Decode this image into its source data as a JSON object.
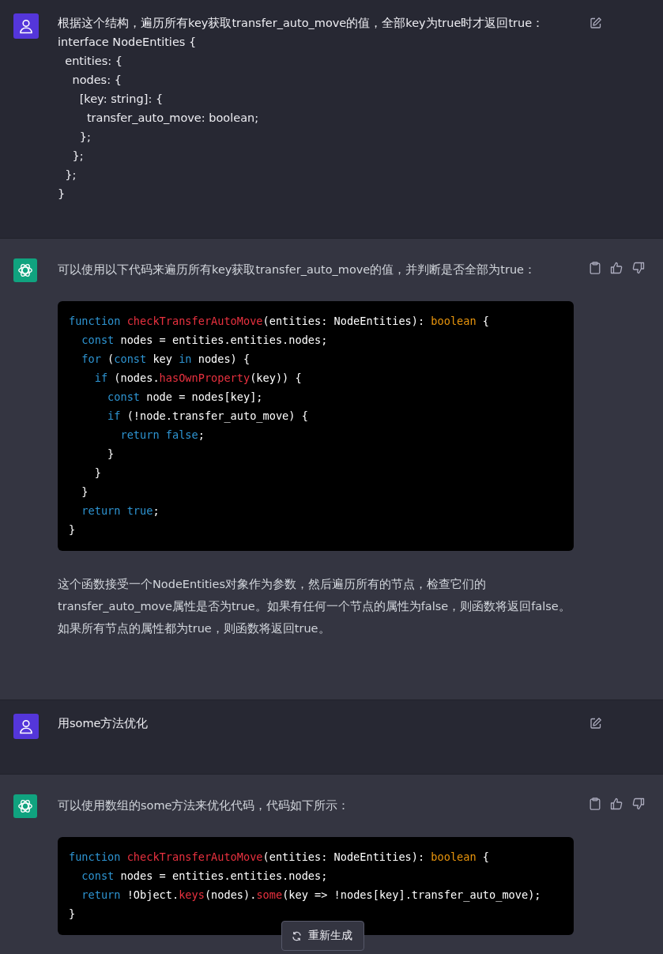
{
  "messages": [
    {
      "kind": "user",
      "blocks": [
        {
          "kind": "text",
          "text": "根据这个结构，遍历所有key获取transfer_auto_move的值，全部key为true时才返回true：\ninterface NodeEntities {\n  entities: {\n    nodes: {\n      [key: string]: {\n        transfer_auto_move: boolean;\n      };\n    };\n  };\n}"
        }
      ]
    },
    {
      "kind": "assistant",
      "blocks": [
        {
          "kind": "text",
          "text": "可以使用以下代码来遍历所有key获取transfer_auto_move的值，并判断是否全部为true："
        },
        {
          "kind": "code",
          "lines": [
            [
              {
                "kind": "keyword",
                "text": "function "
              },
              {
                "kind": "function",
                "text": "checkTransferAutoMove"
              },
              {
                "kind": "plain",
                "text": "(entities: NodeEntities): "
              },
              {
                "kind": "type",
                "text": "boolean"
              },
              {
                "kind": "plain",
                "text": " {"
              }
            ],
            [
              {
                "kind": "keyword",
                "text": "  const"
              },
              {
                "kind": "plain",
                "text": " nodes = entities.entities.nodes;"
              }
            ],
            [
              {
                "kind": "keyword",
                "text": "  for"
              },
              {
                "kind": "plain",
                "text": " ("
              },
              {
                "kind": "keyword",
                "text": "const"
              },
              {
                "kind": "plain",
                "text": " key "
              },
              {
                "kind": "keyword",
                "text": "in"
              },
              {
                "kind": "plain",
                "text": " nodes) {"
              }
            ],
            [
              {
                "kind": "keyword",
                "text": "    if"
              },
              {
                "kind": "plain",
                "text": " (nodes."
              },
              {
                "kind": "function",
                "text": "hasOwnProperty"
              },
              {
                "kind": "plain",
                "text": "(key)) {"
              }
            ],
            [
              {
                "kind": "keyword",
                "text": "      const"
              },
              {
                "kind": "plain",
                "text": " node = nodes[key];"
              }
            ],
            [
              {
                "kind": "keyword",
                "text": "      if"
              },
              {
                "kind": "plain",
                "text": " (!node.transfer_auto_move) {"
              }
            ],
            [
              {
                "kind": "keyword",
                "text": "        return false"
              },
              {
                "kind": "plain",
                "text": ";"
              }
            ],
            [
              {
                "kind": "plain",
                "text": "      }"
              }
            ],
            [
              {
                "kind": "plain",
                "text": "    }"
              }
            ],
            [
              {
                "kind": "plain",
                "text": "  }"
              }
            ],
            [
              {
                "kind": "keyword",
                "text": "  return true"
              },
              {
                "kind": "plain",
                "text": ";"
              }
            ],
            [
              {
                "kind": "plain",
                "text": "}"
              }
            ]
          ]
        },
        {
          "kind": "text",
          "text": "这个函数接受一个NodeEntities对象作为参数，然后遍历所有的节点，检查它们的transfer_auto_move属性是否为true。如果有任何一个节点的属性为false，则函数将返回false。如果所有节点的属性都为true，则函数将返回true。"
        }
      ]
    },
    {
      "kind": "user",
      "blocks": [
        {
          "kind": "text",
          "text": "用some方法优化"
        }
      ]
    },
    {
      "kind": "assistant",
      "blocks": [
        {
          "kind": "text",
          "text": "可以使用数组的some方法来优化代码，代码如下所示："
        },
        {
          "kind": "code",
          "lines": [
            [
              {
                "kind": "keyword",
                "text": "function "
              },
              {
                "kind": "function",
                "text": "checkTransferAutoMove"
              },
              {
                "kind": "plain",
                "text": "(entities: NodeEntities): "
              },
              {
                "kind": "type",
                "text": "boolean"
              },
              {
                "kind": "plain",
                "text": " {"
              }
            ],
            [
              {
                "kind": "keyword",
                "text": "  const"
              },
              {
                "kind": "plain",
                "text": " nodes = entities.entities.nodes;"
              }
            ],
            [
              {
                "kind": "keyword",
                "text": "  return"
              },
              {
                "kind": "plain",
                "text": " !Object."
              },
              {
                "kind": "function",
                "text": "keys"
              },
              {
                "kind": "plain",
                "text": "(nodes)."
              },
              {
                "kind": "function",
                "text": "some"
              },
              {
                "kind": "plain",
                "text": "(key => !nodes[key].transfer_auto_move);"
              }
            ],
            [
              {
                "kind": "plain",
                "text": "}"
              }
            ]
          ]
        }
      ]
    }
  ],
  "regenerate_button": "重新生成"
}
